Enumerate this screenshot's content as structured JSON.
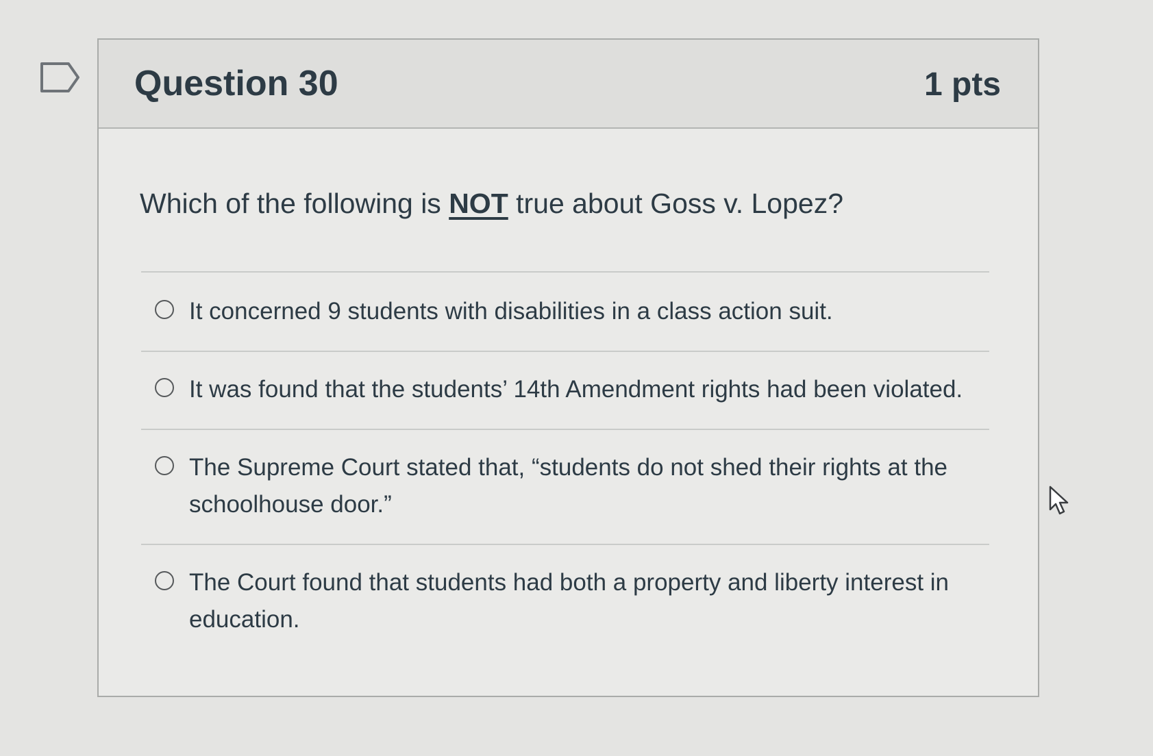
{
  "question": {
    "title": "Question 30",
    "points": "1 pts",
    "prompt_before": "Which of the following is ",
    "prompt_emphasis": "NOT",
    "prompt_after": " true about Goss v. Lopez?"
  },
  "answers": [
    {
      "label": "It concerned 9 students with disabilities in a class action suit.",
      "selected": false
    },
    {
      "label": "It was found that the students’ 14th Amendment rights had been violated.",
      "selected": false
    },
    {
      "label": "The Supreme Court stated that, “students do not shed their rights at the schoolhouse door.”",
      "selected": false
    },
    {
      "label": "The Court found that students had both a property and liberty interest in education.",
      "selected": false
    }
  ],
  "icons": {
    "flag": "flag-question-icon",
    "cursor": "mouse-pointer-icon"
  },
  "colors": {
    "background": "#e4e4e2",
    "card": "#eaeae8",
    "header": "#dededc",
    "text": "#2d3b45",
    "border": "#a9aba9"
  }
}
